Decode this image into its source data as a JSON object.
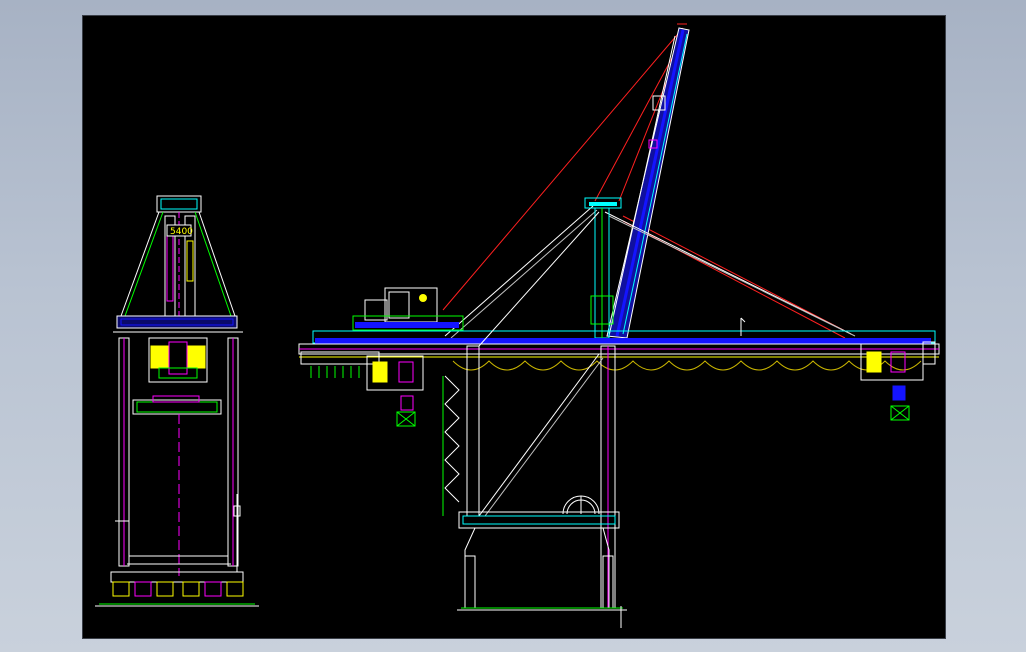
{
  "canvas": {
    "background": "#000000",
    "window_background": "#b3bdcc"
  },
  "annotations": {
    "end_view_dimension": "5400"
  },
  "colors": {
    "structure_white": "#ffffff",
    "boom_blue": "#1414ff",
    "trolley_yellow": "#ffff00",
    "stay_red": "#ff2020",
    "detail_cyan": "#00ffff",
    "detail_magenta": "#ff00ff",
    "detail_green": "#00ff00",
    "cable_yellow": "#c8b400"
  }
}
